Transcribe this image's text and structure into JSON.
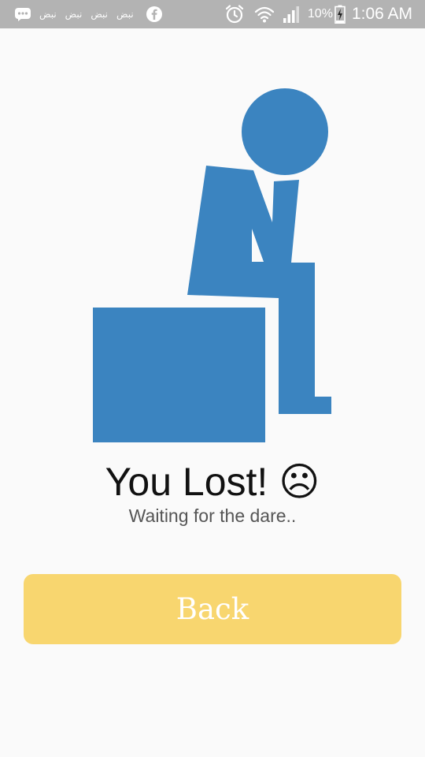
{
  "status_bar": {
    "notifications": [
      "نبض",
      "نبض",
      "نبض",
      "نبض"
    ],
    "battery_percent": "10%",
    "time": "1:06 AM",
    "icons": [
      "message-icon",
      "facebook-icon",
      "alarm-icon",
      "wifi-icon",
      "signal-icon",
      "battery-charging-icon"
    ]
  },
  "main": {
    "illustration_icon": "sad-sitting-person-icon",
    "title": "You Lost!",
    "title_emoji": "☹",
    "subtitle": "Waiting for the dare..",
    "back_button_label": "Back"
  },
  "colors": {
    "status_bar": "#b3b3b3",
    "background": "#fafafa",
    "illustration": "#3b84c0",
    "button": "#f8d66f"
  }
}
